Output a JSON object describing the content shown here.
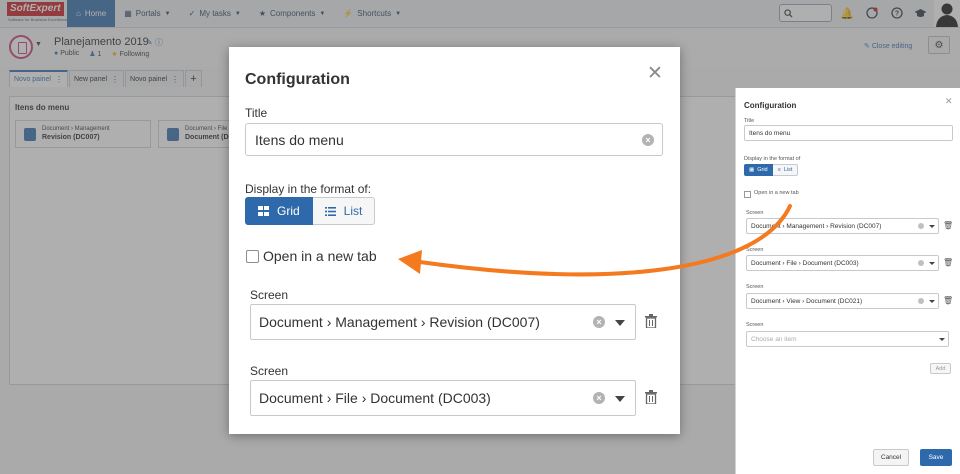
{
  "logo": {
    "brand_a": "Soft",
    "brand_b": "Expert",
    "tagline": "Software for Business Excellence"
  },
  "nav": {
    "items": [
      {
        "label": "Home",
        "icon": "home-icon"
      },
      {
        "label": "Portals",
        "icon": "grid-icon"
      },
      {
        "label": "My tasks",
        "icon": "check-icon"
      },
      {
        "label": "Components",
        "icon": "trophy-icon"
      },
      {
        "label": "Shortcuts",
        "icon": "lightning-icon"
      }
    ],
    "search_placeholder": ""
  },
  "page": {
    "title": "Planejamento 2019",
    "visibility": "Public",
    "members": "1",
    "following": "Following",
    "close_editing": "Close editing"
  },
  "tabs": [
    "Novo painel",
    "New panel",
    "Novo painel"
  ],
  "panel": {
    "title": "Itens do menu",
    "cards": [
      {
        "path": "Document › Management",
        "name": "Revision (DC007)"
      },
      {
        "path": "Document › File",
        "name": "Document (DC003)"
      }
    ]
  },
  "modal": {
    "title": "Configuration",
    "title_label": "Title",
    "title_value": "Itens do menu",
    "display_label": "Display in the format of:",
    "grid_label": "Grid",
    "list_label": "List",
    "new_tab_label": "Open in a new tab",
    "screen_label": "Screen",
    "screens": [
      "Document › Management › Revision (DC007)",
      "Document › File › Document (DC003)"
    ]
  },
  "side": {
    "title": "Configuration",
    "title_label": "Title",
    "title_value": "Itens do menu",
    "display_label": "Display in the format of",
    "grid_label": "Grid",
    "list_label": "List",
    "new_tab_label": "Open in a new tab",
    "screen_label": "Screen",
    "screens": [
      "Document › Management › Revision (DC007)",
      "Document › File › Document (DC003)",
      "Document › View › Document (DC021)"
    ],
    "empty_placeholder": "Choose an item",
    "add_label": "Add",
    "cancel_label": "Cancel",
    "save_label": "Save"
  },
  "colors": {
    "accent": "#2e6aab",
    "arrow": "#f47a20",
    "brand_red": "#c8171e"
  }
}
